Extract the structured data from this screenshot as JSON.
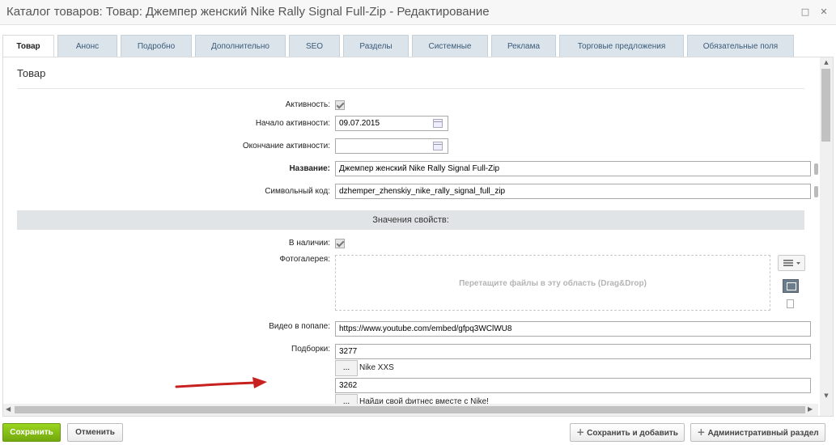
{
  "window": {
    "title": "Каталог товаров: Товар: Джемпер женский Nike Rally Signal Full-Zip - Редактирование",
    "maximize_glyph": "□",
    "close_glyph": "✕"
  },
  "tabs": [
    {
      "label": "Товар",
      "active": true
    },
    {
      "label": "Анонс"
    },
    {
      "label": "Подробно"
    },
    {
      "label": "Дополнительно"
    },
    {
      "label": "SEO"
    },
    {
      "label": "Разделы"
    },
    {
      "label": "Системные"
    },
    {
      "label": "Реклама"
    },
    {
      "label": "Торговые предложения"
    },
    {
      "label": "Обязательные поля"
    }
  ],
  "section_title": "Товар",
  "fields": {
    "active_label": "Активность:",
    "active_checked": true,
    "start_label": "Начало активности:",
    "start_value": "09.07.2015",
    "end_label": "Окончание активности:",
    "end_value": "",
    "name_label": "Название:",
    "name_value": "Джемпер женский Nike Rally Signal Full-Zip",
    "code_label": "Символьный код:",
    "code_value": "dzhemper_zhenskiy_nike_rally_signal_full_zip"
  },
  "properties": {
    "header": "Значения свойств:",
    "in_stock_label": "В наличии:",
    "in_stock_checked": true,
    "gallery_label": "Фотогалерея:",
    "dropzone_text": "Перетащите файлы в эту область (Drag&Drop)",
    "video_label": "Видео в попапе:",
    "video_value": "https://www.youtube.com/embed/gfpq3WClWU8",
    "selections_label": "Подборки:",
    "selection_1_id": "3277",
    "selection_1_name": "Nike XXS",
    "browse_label": "...",
    "selection_2_id": "3262",
    "selection_2_name": "Найди свой фитнес вместе с Nike!"
  },
  "footer": {
    "save": "Сохранить",
    "cancel": "Отменить",
    "save_add": "Сохранить и добавить",
    "admin": "Административный раздел"
  },
  "colors": {
    "save_button": "#7cb518",
    "annotation_arrow": "#c8201e"
  }
}
